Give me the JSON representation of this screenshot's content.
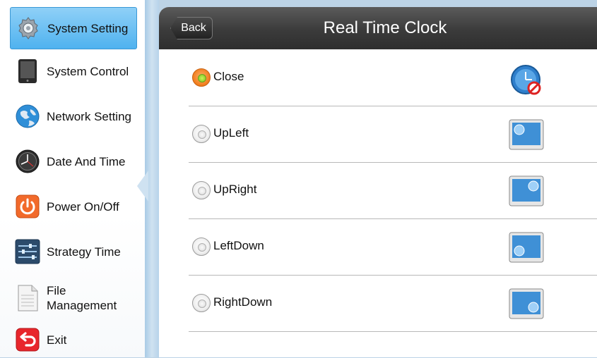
{
  "sidebar": {
    "items": [
      {
        "label": "System Setting",
        "icon": "gear-icon",
        "active": true
      },
      {
        "label": "System Control",
        "icon": "tablet-icon",
        "active": false
      },
      {
        "label": "Network Setting",
        "icon": "globe-icon",
        "active": false
      },
      {
        "label": "Date And Time",
        "icon": "clock-icon",
        "active": false
      },
      {
        "label": "Power On/Off",
        "icon": "power-icon",
        "active": false
      },
      {
        "label": "Strategy Time",
        "icon": "sliders-icon",
        "active": false
      },
      {
        "label": "File\nManagement",
        "icon": "document-icon",
        "active": false
      },
      {
        "label": "Exit",
        "icon": "exit-icon",
        "active": false
      }
    ]
  },
  "header": {
    "back_label": "Back",
    "title": "Real Time Clock"
  },
  "options": [
    {
      "label": "Close",
      "selected": true,
      "icon": "clock-disabled-icon"
    },
    {
      "label": "UpLeft",
      "selected": false,
      "icon": "screen-clock-upleft-icon"
    },
    {
      "label": "UpRight",
      "selected": false,
      "icon": "screen-clock-upright-icon"
    },
    {
      "label": "LeftDown",
      "selected": false,
      "icon": "screen-clock-leftdown-icon"
    },
    {
      "label": "RightDown",
      "selected": false,
      "icon": "screen-clock-rightdown-icon"
    }
  ],
  "colors": {
    "active_item": "#4fb2ef",
    "header": "#3b3b3b",
    "radio_selected": "#f07c1b"
  }
}
